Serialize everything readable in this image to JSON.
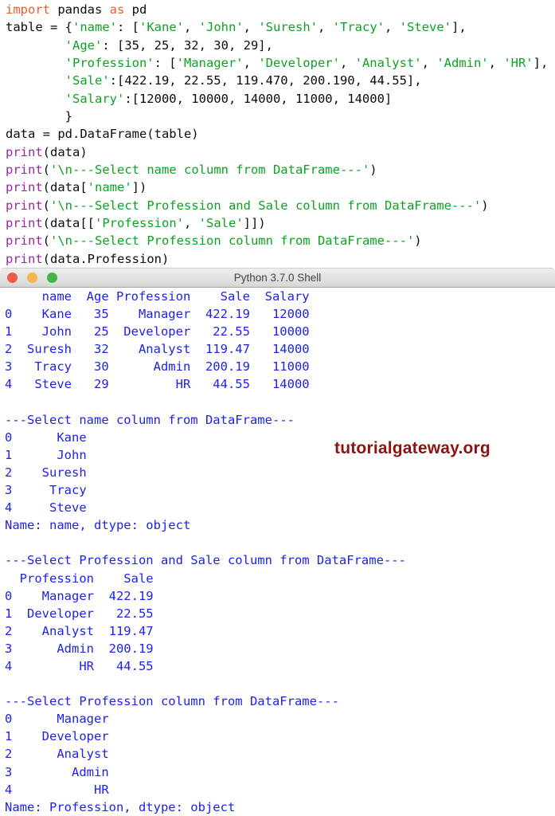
{
  "editor": {
    "lines": [
      [
        [
          "kw",
          "import"
        ],
        [
          "pl",
          " pandas "
        ],
        [
          "kw",
          "as"
        ],
        [
          "pl",
          " pd"
        ]
      ],
      [
        [
          "pl",
          "table = {"
        ],
        [
          "str",
          "'name'"
        ],
        [
          "pl",
          ": ["
        ],
        [
          "str",
          "'Kane'"
        ],
        [
          "pl",
          ", "
        ],
        [
          "str",
          "'John'"
        ],
        [
          "pl",
          ", "
        ],
        [
          "str",
          "'Suresh'"
        ],
        [
          "pl",
          ", "
        ],
        [
          "str",
          "'Tracy'"
        ],
        [
          "pl",
          ", "
        ],
        [
          "str",
          "'Steve'"
        ],
        [
          "pl",
          "],"
        ]
      ],
      [
        [
          "pl",
          "        "
        ],
        [
          "str",
          "'Age'"
        ],
        [
          "pl",
          ": [35, 25, 32, 30, 29],"
        ]
      ],
      [
        [
          "pl",
          "        "
        ],
        [
          "str",
          "'Profession'"
        ],
        [
          "pl",
          ": ["
        ],
        [
          "str",
          "'Manager'"
        ],
        [
          "pl",
          ", "
        ],
        [
          "str",
          "'Developer'"
        ],
        [
          "pl",
          ", "
        ],
        [
          "str",
          "'Analyst'"
        ],
        [
          "pl",
          ", "
        ],
        [
          "str",
          "'Admin'"
        ],
        [
          "pl",
          ", "
        ],
        [
          "str",
          "'HR'"
        ],
        [
          "pl",
          "],"
        ]
      ],
      [
        [
          "pl",
          "        "
        ],
        [
          "str",
          "'Sale'"
        ],
        [
          "pl",
          ":[422.19, 22.55, 119.470, 200.190, 44.55],"
        ]
      ],
      [
        [
          "pl",
          "        "
        ],
        [
          "str",
          "'Salary'"
        ],
        [
          "pl",
          ":[12000, 10000, 14000, 11000, 14000]"
        ]
      ],
      [
        [
          "pl",
          "        }"
        ]
      ],
      [
        [
          "pl",
          "data = pd.DataFrame(table)"
        ]
      ],
      [
        [
          "bi",
          "print"
        ],
        [
          "pl",
          "(data)"
        ]
      ],
      [
        [
          "bi",
          "print"
        ],
        [
          "pl",
          "("
        ],
        [
          "str",
          "'\\n---Select name column from DataFrame---'"
        ],
        [
          "pl",
          ")"
        ]
      ],
      [
        [
          "bi",
          "print"
        ],
        [
          "pl",
          "(data["
        ],
        [
          "str",
          "'name'"
        ],
        [
          "pl",
          "])"
        ]
      ],
      [
        [
          "bi",
          "print"
        ],
        [
          "pl",
          "("
        ],
        [
          "str",
          "'\\n---Select Profession and Sale column from DataFrame---'"
        ],
        [
          "pl",
          ")"
        ]
      ],
      [
        [
          "bi",
          "print"
        ],
        [
          "pl",
          "(data[["
        ],
        [
          "str",
          "'Profession'"
        ],
        [
          "pl",
          ", "
        ],
        [
          "str",
          "'Sale'"
        ],
        [
          "pl",
          "]])"
        ]
      ],
      [
        [
          "bi",
          "print"
        ],
        [
          "pl",
          "("
        ],
        [
          "str",
          "'\\n---Select Profession column from DataFrame---'"
        ],
        [
          "pl",
          ")"
        ]
      ],
      [
        [
          "bi",
          "print"
        ],
        [
          "pl",
          "(data.Profession)"
        ]
      ]
    ]
  },
  "shell_window": {
    "title": "Python 3.7.0 Shell",
    "traffic_lights": [
      "close",
      "minimize",
      "zoom"
    ]
  },
  "shell": {
    "lines": [
      "     name  Age Profession    Sale  Salary",
      "0    Kane   35    Manager  422.19   12000",
      "1    John   25  Developer   22.55   10000",
      "2  Suresh   32    Analyst  119.47   14000",
      "3   Tracy   30      Admin  200.19   11000",
      "4   Steve   29         HR   44.55   14000",
      "",
      "---Select name column from DataFrame---",
      "0      Kane",
      "1      John",
      "2    Suresh",
      "3     Tracy",
      "4     Steve",
      "Name: name, dtype: object",
      "",
      "---Select Profession and Sale column from DataFrame---",
      "  Profession    Sale",
      "0    Manager  422.19",
      "1  Developer   22.55",
      "2    Analyst  119.47",
      "3      Admin  200.19",
      "4         HR   44.55",
      "",
      "---Select Profession column from DataFrame---",
      "0      Manager",
      "1    Developer",
      "2      Analyst",
      "3        Admin",
      "4           HR",
      "Name: Profession, dtype: object"
    ]
  },
  "watermark": {
    "text": "tutorialgateway.org"
  },
  "colors": {
    "keyword": "#ee5b2c",
    "string": "#0ca321",
    "builtin": "#9a27a2",
    "code_text": "#0b0b0b",
    "shell_text": "#1e22ea",
    "watermark": "#8b1410",
    "light_red": "#f25b43",
    "light_yellow": "#f6b44e",
    "light_green": "#41b645"
  },
  "chart_data": {
    "type": "table",
    "title": "DataFrame",
    "columns": [
      "name",
      "Age",
      "Profession",
      "Sale",
      "Salary"
    ],
    "rows": [
      [
        "Kane",
        35,
        "Manager",
        422.19,
        12000
      ],
      [
        "John",
        25,
        "Developer",
        22.55,
        10000
      ],
      [
        "Suresh",
        32,
        "Analyst",
        119.47,
        14000
      ],
      [
        "Tracy",
        30,
        "Admin",
        200.19,
        11000
      ],
      [
        "Steve",
        29,
        "HR",
        44.55,
        14000
      ]
    ]
  }
}
